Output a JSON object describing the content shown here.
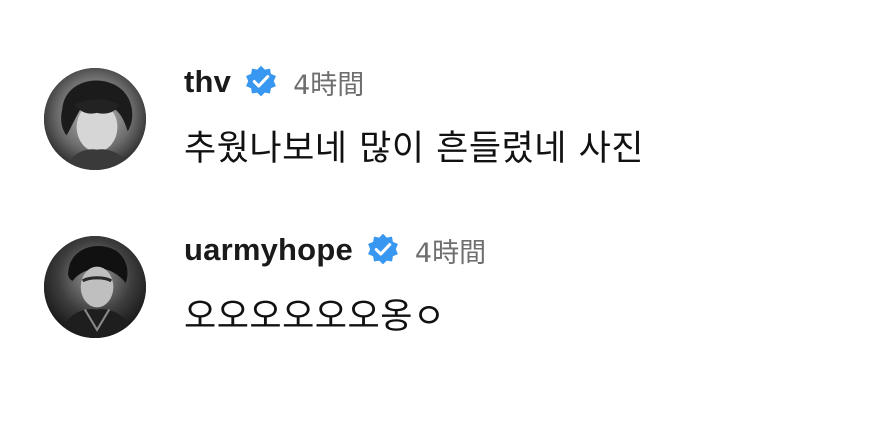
{
  "comments": [
    {
      "username": "thv",
      "verified": true,
      "time": "4時間",
      "text": "추웠나보네 많이 흔들렸네 사진",
      "avatar_icon": "profile-photo"
    },
    {
      "username": "uarmyhope",
      "verified": true,
      "time": "4時間",
      "text": "오오오오오오옹ㅇ",
      "avatar_icon": "profile-photo"
    }
  ],
  "colors": {
    "verified_badge": "#3897f0",
    "timestamp": "#6f6f6f",
    "text": "#111111"
  }
}
